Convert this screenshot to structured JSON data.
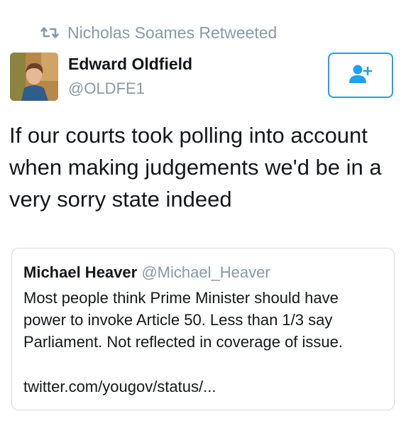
{
  "retweet": {
    "icon": "retweet-icon",
    "label": "Nicholas Soames Retweeted"
  },
  "author": {
    "name": "Edward Oldfield",
    "handle": "@OLDFE1",
    "avatar": "profile-photo"
  },
  "follow_button": {
    "icon": "add-user-icon",
    "color": "#1da1f2"
  },
  "tweet": {
    "text": "If our courts took polling into account when making judgements we'd be in a very sorry state indeed"
  },
  "quoted_tweet": {
    "name": "Michael Heaver",
    "handle": "@Michael_Heaver",
    "text": "Most people think Prime Minister should have power to invoke Article 50. Less than 1/3 say Parliament. Not reflected in coverage of issue.",
    "link": "twitter.com/yougov/status/..."
  },
  "colors": {
    "accent": "#1da1f2",
    "secondary_text": "#8899a6",
    "primary_text": "#14171a",
    "border": "#d6dce0"
  }
}
